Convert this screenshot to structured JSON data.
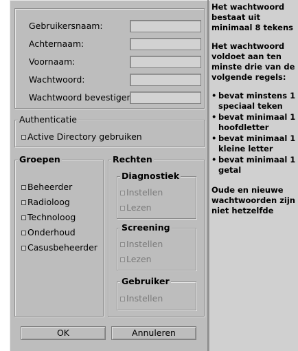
{
  "fields": [
    {
      "label": "Gebruikersnaam:",
      "value": ""
    },
    {
      "label": "Achternaam:",
      "value": ""
    },
    {
      "label": "Voornaam:",
      "value": ""
    },
    {
      "label": "Wachtwoord:",
      "value": ""
    },
    {
      "label": "Wachtwoord bevestigen:",
      "value": ""
    }
  ],
  "authentication": {
    "title": "Authenticatie",
    "checkbox_label": "Active Directory gebruiken",
    "checked": false
  },
  "groups": {
    "title": "Groepen",
    "items": [
      "Beheerder",
      "Radioloog",
      "Technoloog",
      "Onderhoud",
      "Casusbeheerder"
    ]
  },
  "rights": {
    "title": "Rechten",
    "diagnostiek": {
      "title": "Diagnostiek",
      "items": [
        "Instellen",
        "Lezen"
      ]
    },
    "screening": {
      "title": "Screening",
      "items": [
        "Instellen",
        "Lezen"
      ]
    },
    "gebruiker": {
      "title": "Gebruiker",
      "items": [
        "Instellen"
      ]
    }
  },
  "buttons": {
    "ok": "OK",
    "cancel": "Annuleren"
  },
  "help": {
    "p1": "Het wachtwoord bestaat uit minimaal 8 tekens",
    "p2": "Het wachtwoord voldoet aan ten minste drie van de volgende regels:",
    "rules": [
      "bevat minstens 1 speciaal teken",
      "bevat minimaal 1 hoofdletter",
      "bevat minimaal 1 kleine letter",
      "bevat minimaal 1 getal"
    ],
    "p3": "Oude en nieuwe wachtwoorden zijn niet hetzelfde"
  },
  "colors": {
    "background": "#bdbdbd",
    "help_panel": "#d0d0d0"
  }
}
